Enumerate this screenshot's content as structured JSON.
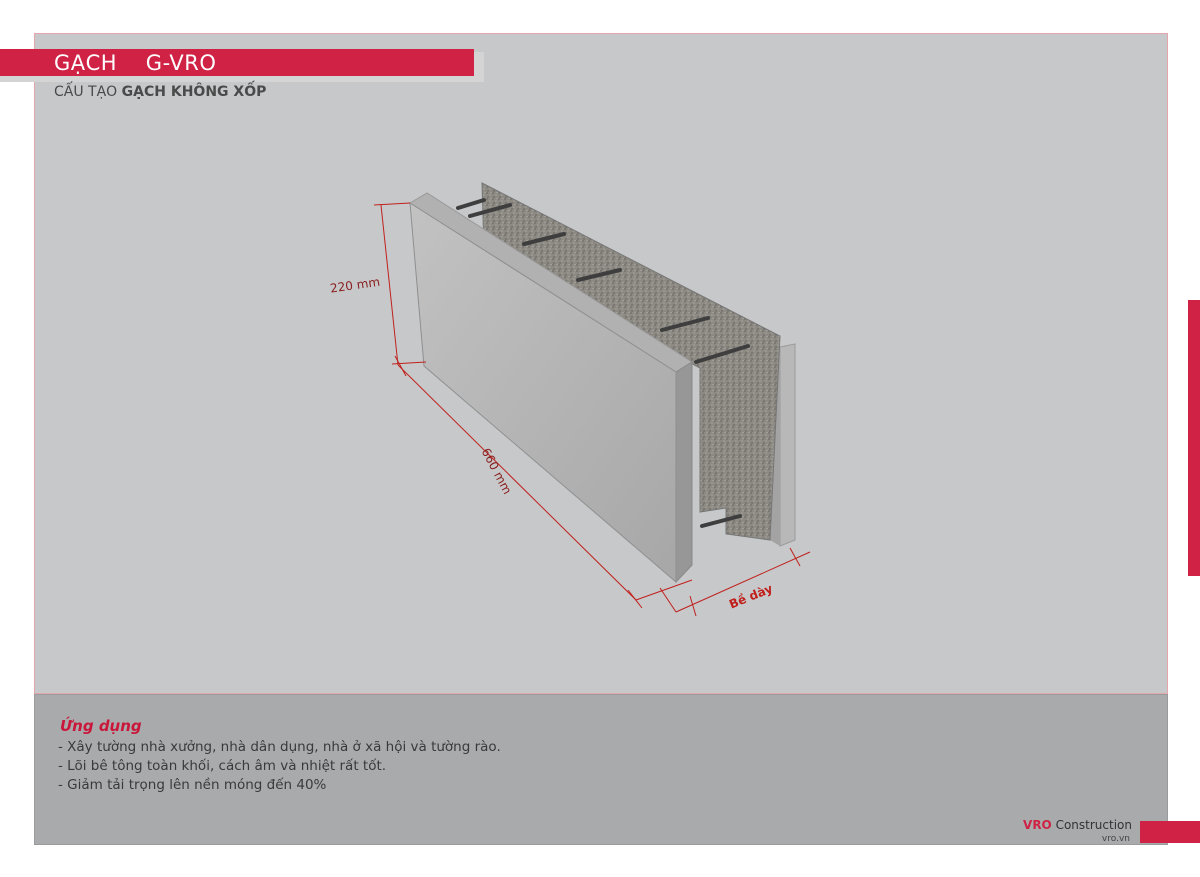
{
  "header": {
    "title": "GẠCH    G-VRO",
    "subtitle_prefix": "CẤU TẠO ",
    "subtitle_bold": "GẠCH KHÔNG XỐP"
  },
  "diagram": {
    "height_label": "220 mm",
    "length_label": "660 mm",
    "thickness_label": "Bề dày"
  },
  "applications": {
    "heading": "Ứng dụng",
    "items": [
      "- Xây tường nhà xưởng, nhà dân dụng, nhà ở xã hội và tường rào.",
      "- Lõi bê tông toàn khối, cách âm và nhiệt rất tốt.",
      "- Giảm tải trọng lên nền móng đến 40%"
    ]
  },
  "footer": {
    "brand_bold": "VRO",
    "brand_rest": " Construction",
    "url": "vro.vn"
  },
  "colors": {
    "accent": "#cf2244",
    "background": "#c6c8ca",
    "panel": "#a9aaac"
  }
}
